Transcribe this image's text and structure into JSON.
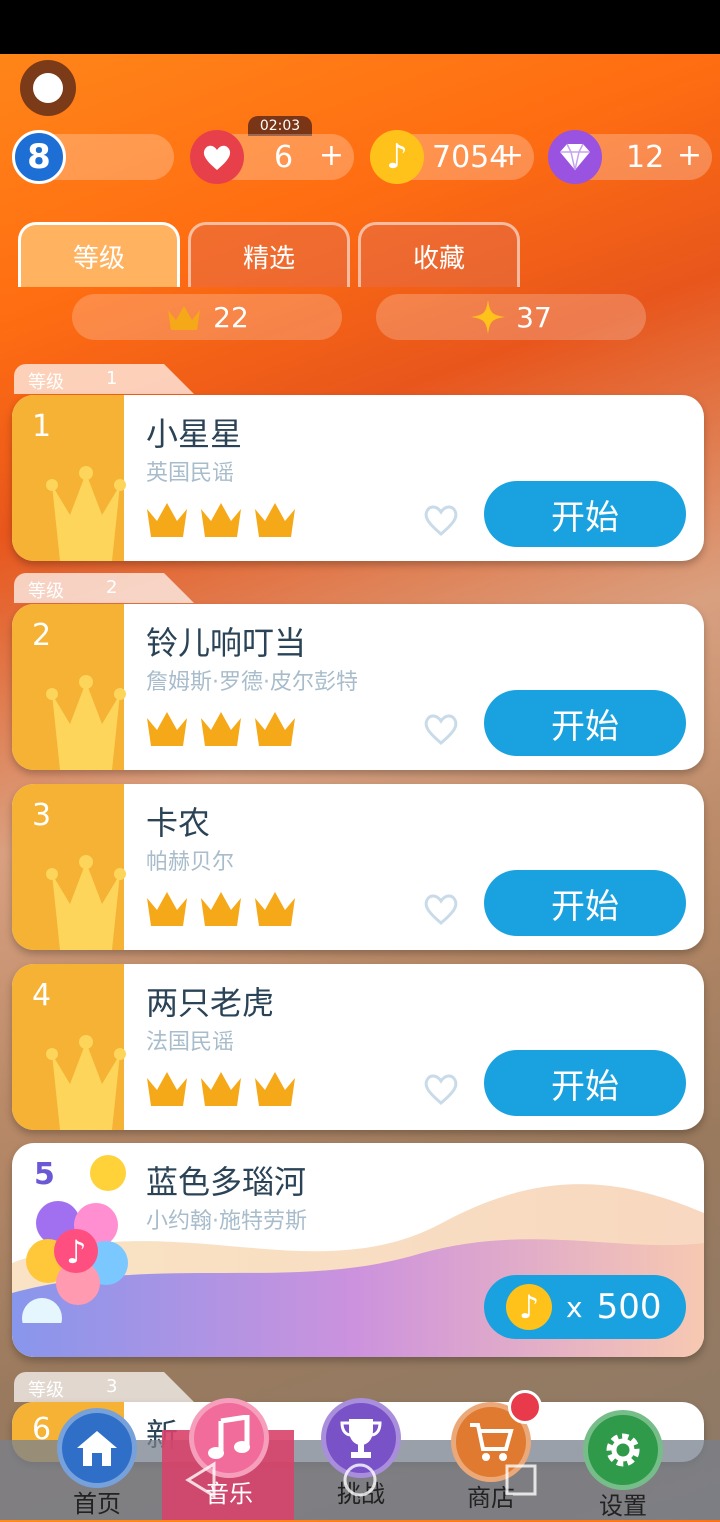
{
  "header": {
    "level_badge": "8",
    "lives": {
      "timer": "02:03",
      "value": "6",
      "plus": "+"
    },
    "notes": {
      "value": "7054",
      "plus": "+"
    },
    "gems": {
      "value": "12",
      "plus": "+"
    }
  },
  "tabs": [
    {
      "label": "等级",
      "active": true
    },
    {
      "label": "精选",
      "active": false
    },
    {
      "label": "收藏",
      "active": false
    }
  ],
  "stats": {
    "crowns": "22",
    "stars": "37"
  },
  "level_headers": [
    {
      "label": "等级",
      "num": "1"
    },
    {
      "label": "等级",
      "num": "2"
    },
    {
      "label": "等级",
      "num": "3"
    }
  ],
  "songs": [
    {
      "num": "1",
      "title": "小星星",
      "artist": "英国民谣",
      "button": "开始"
    },
    {
      "num": "2",
      "title": "铃儿响叮当",
      "artist": "詹姆斯·罗德·皮尔彭特",
      "button": "开始"
    },
    {
      "num": "3",
      "title": "卡农",
      "artist": "帕赫贝尔",
      "button": "开始"
    },
    {
      "num": "4",
      "title": "两只老虎",
      "artist": "法国民谣",
      "button": "开始"
    }
  ],
  "special_song": {
    "num": "5",
    "title": "蓝色多瑙河",
    "artist": "小约翰·施特劳斯",
    "cost_prefix": "x",
    "cost": "500"
  },
  "partial_song": {
    "num": "6",
    "title": "新"
  },
  "bottom_nav": [
    {
      "label": "首页",
      "active": false
    },
    {
      "label": "音乐",
      "active": true
    },
    {
      "label": "挑战",
      "active": false
    },
    {
      "label": "商店",
      "active": false
    },
    {
      "label": "设置",
      "active": false
    }
  ],
  "colors": {
    "accent_blue": "#1aa2e0",
    "card_side": "#f5b234",
    "crown": "#f5a818"
  }
}
